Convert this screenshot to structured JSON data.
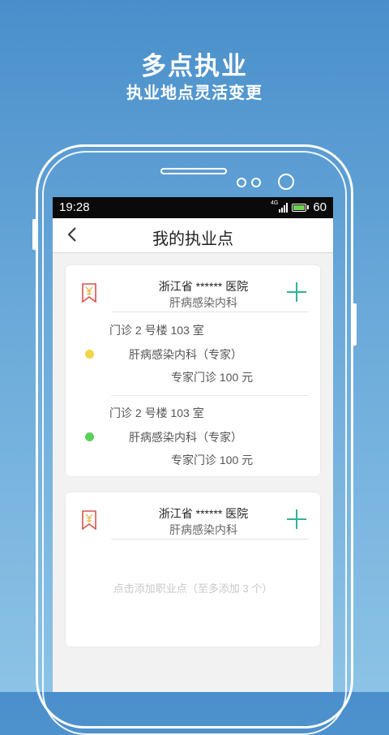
{
  "promo": {
    "title": "多点执业",
    "subtitle": "执业地点灵活变更"
  },
  "statusbar": {
    "time": "19:28",
    "network": "4G",
    "battery": "60"
  },
  "navbar": {
    "title": "我的执业点"
  },
  "cards": [
    {
      "hospital": "浙江省 ****** 医院",
      "department": "肝病感染内科",
      "places": [
        {
          "location": "门诊 2 号楼  103 室",
          "dept_detail": "肝病感染内科（专家）",
          "fee": "专家门诊  100 元",
          "dot_color": "#f2d44a"
        },
        {
          "location": "门诊 2 号楼  103 室",
          "dept_detail": "肝病感染内科（专家）",
          "fee": "专家门诊  100 元",
          "dot_color": "#5bd15b"
        }
      ]
    },
    {
      "hospital": "浙江省 ****** 医院",
      "department": "肝病感染内科",
      "empty_hint": "点击添加职业点（至多添加 3 个）"
    }
  ],
  "colors": {
    "accent": "#2fb39a",
    "rmb_icon": "#d9534f"
  }
}
